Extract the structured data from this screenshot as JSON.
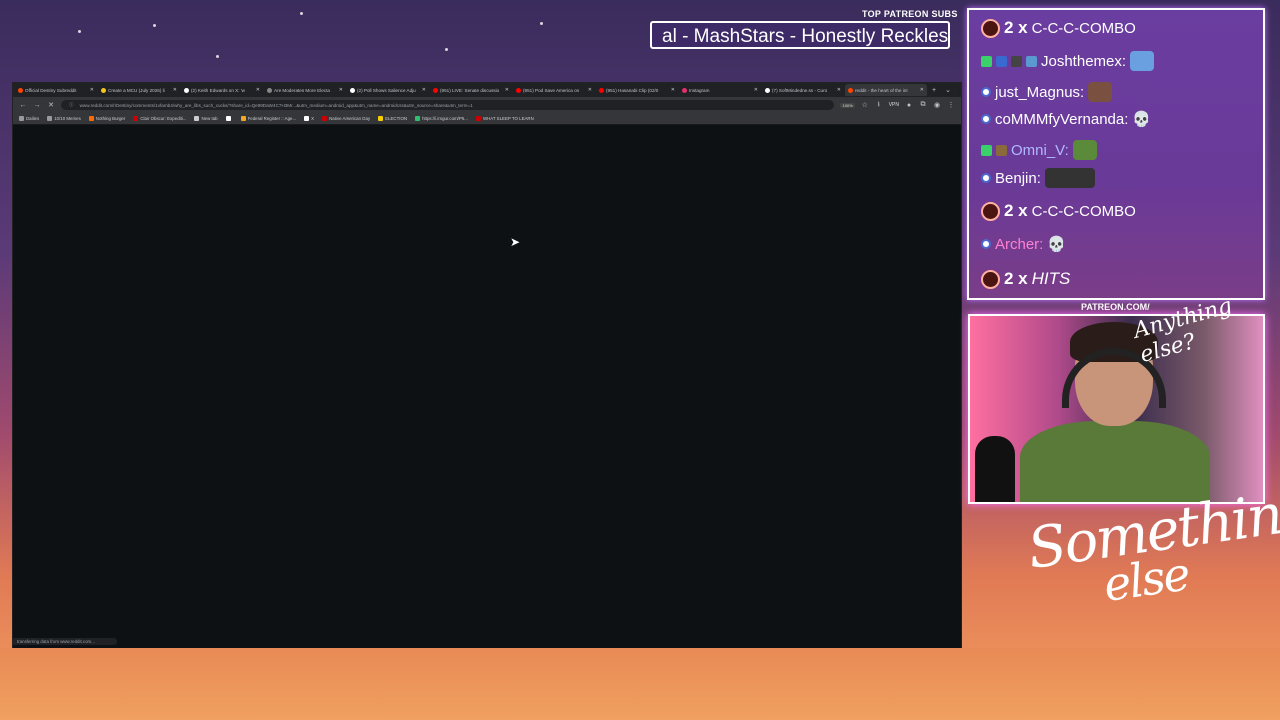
{
  "overlay": {
    "patreon_header": "TOP PATREON SUBS",
    "marquee_text": "al - MashStars - Honestly Reckles",
    "webcam_label": "PATREON.COM/",
    "webcam_script": "Anything else?",
    "branding_line1": "Something",
    "branding_line2": "else"
  },
  "chat": {
    "messages": [
      {
        "count": "2 x",
        "text": "C-C-C-COMBO"
      },
      {
        "name": "Joshthemex:",
        "text": ""
      },
      {
        "name": "just_Magnus:",
        "text": ""
      },
      {
        "name": "coMMMfyVernanda:",
        "text": ""
      },
      {
        "name": "Omni_V:",
        "text": ""
      },
      {
        "name": "Benjin:",
        "text": ""
      },
      {
        "count": "2 x",
        "text": "C-C-C-COMBO"
      },
      {
        "name": "Archer:",
        "text": ""
      },
      {
        "count": "2 x",
        "text": "HITS"
      }
    ]
  },
  "browser": {
    "tabs": [
      {
        "label": "Official Destiny Subreddit",
        "color": "#ff4500"
      },
      {
        "label": "Create a MCU (July 2026) li",
        "color": "#f5c518"
      },
      {
        "label": "(2) Keith Edwards on X: 'w",
        "color": "#ffffff"
      },
      {
        "label": "Are Moderates More Electa",
        "color": "#888888"
      },
      {
        "label": "(2) Poll Shows Salience Adju",
        "color": "#ffffff"
      },
      {
        "label": "(951) LIVE: Senate discussio",
        "color": "#ff0000"
      },
      {
        "label": "(951) Pod Save America on",
        "color": "#ff0000"
      },
      {
        "label": "(951) Hasanabi Clip (02/0",
        "color": "#ff0000"
      },
      {
        "label": "Instagram",
        "color": "#e1306c"
      },
      {
        "label": "(7) SoftMindedne.ss - Curo",
        "color": "#ffffff"
      },
      {
        "label": "reddit - the heart of the int",
        "color": "#ff4500"
      }
    ],
    "active_tab_index": 10,
    "url": "www.reddit.com/r/Destiny/comments/1vfamb4/why_are_libs_such_cucks/?share_id=Qe99DaW4C7H3Mr...&utm_medium=android_app&utm_name=androidcss&utm_source=share&utm_term=1",
    "zoom": "100%",
    "vpn_label": "VPN",
    "bookmarks": [
      {
        "label": "Dailies",
        "color": "#999999"
      },
      {
        "label": "10/10 Memes",
        "color": "#999999"
      },
      {
        "label": "Nothing Burger",
        "color": "#ff6b00"
      },
      {
        "label": "Clair Obscur: Expediti...",
        "color": "#cc0000"
      },
      {
        "label": "New tab",
        "color": "#cccccc"
      },
      {
        "label": "",
        "color": "#ffffff"
      },
      {
        "label": "Federal Register :: Age...",
        "color": "#f5a623"
      },
      {
        "label": "X",
        "color": "#ffffff"
      },
      {
        "label": "Native American Day",
        "color": "#cc0000"
      },
      {
        "label": "ELECTION",
        "color": "#f5d000"
      },
      {
        "label": "https://i.imgur.com/P5...",
        "color": "#2fbf71"
      },
      {
        "label": "WHAT SLEEP TO LEARN",
        "color": "#cc0000"
      }
    ],
    "status_text": "transferring data from www.reddit.com..."
  }
}
